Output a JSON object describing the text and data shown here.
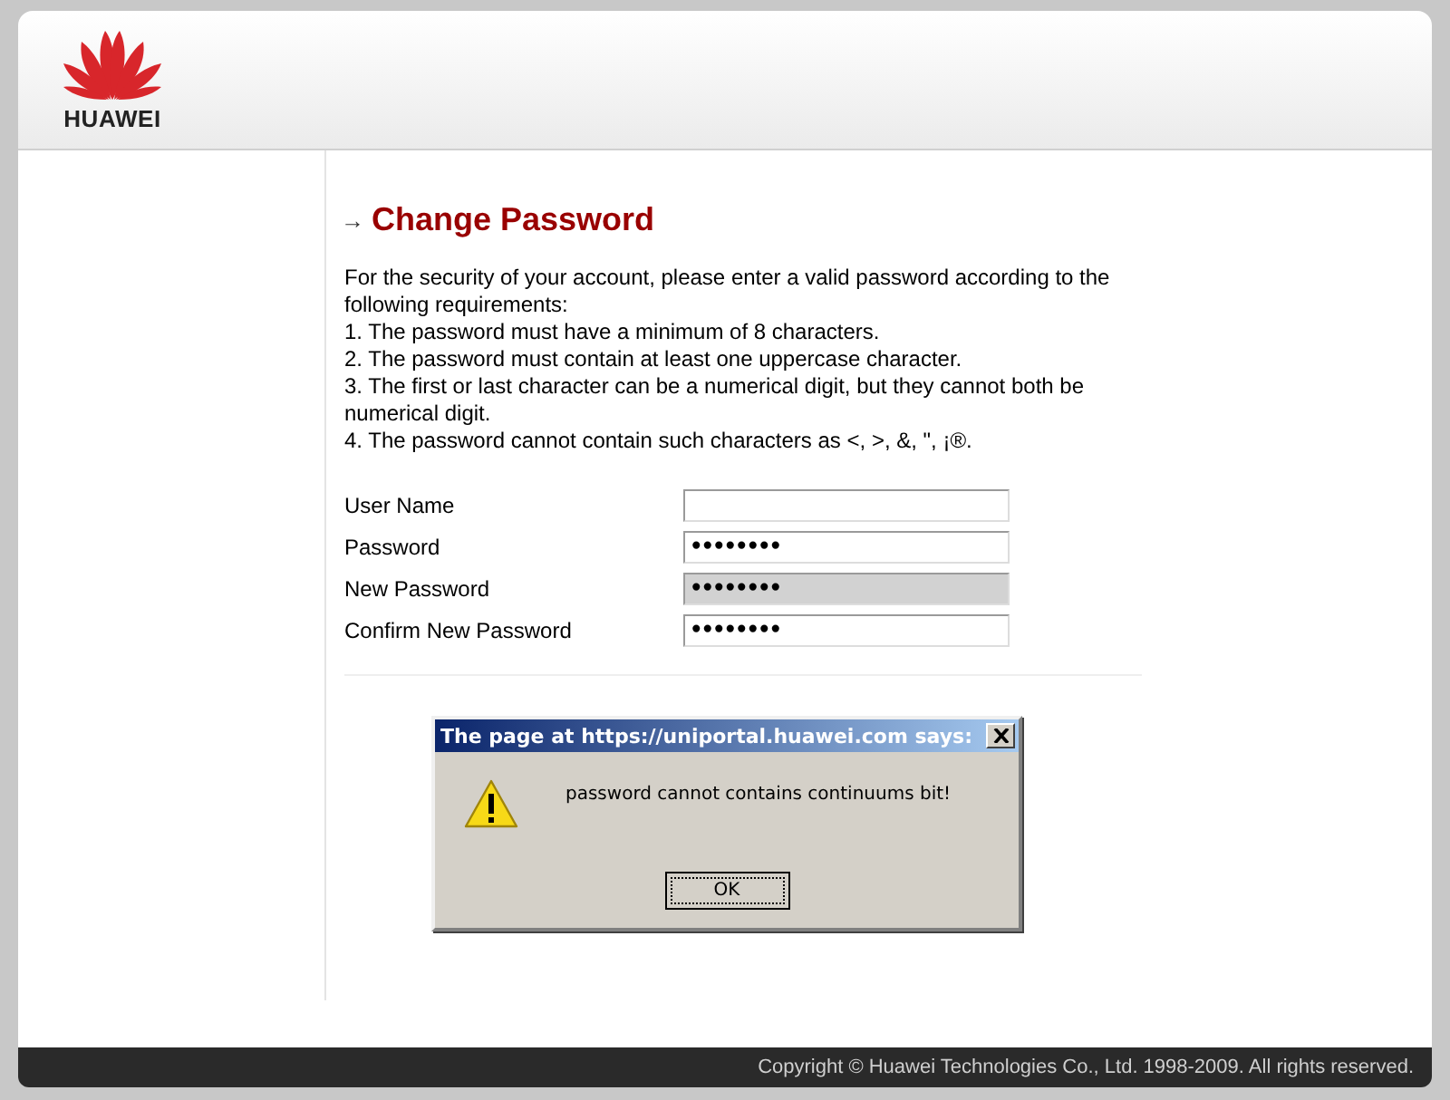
{
  "header": {
    "logo_text": "HUAWEI"
  },
  "page": {
    "title_icon": "→",
    "title": "Change Password",
    "intro": "For the security of your account, please enter a valid password according to the following requirements:",
    "requirements": [
      "1. The password must have a minimum of 8 characters.",
      "2. The password must contain at least one uppercase character.",
      "3. The first or last character can be a numerical digit, but they cannot both be numerical digit.",
      "4. The password cannot contain such characters as <, >, &, \", ¡®."
    ]
  },
  "form": [
    {
      "label": "User Name",
      "disabled": false
    },
    {
      "label": "Password",
      "value": "••••••••",
      "disabled": false
    },
    {
      "label": "New Password",
      "value": "••••••••",
      "disabled": true
    },
    {
      "label": "Confirm New Password",
      "value": "••••••••",
      "disabled": false
    }
  ],
  "dialog": {
    "title": "The page at https://uniportal.huawei.com says:",
    "message": "password cannot contains continuums bit!",
    "buttons": [
      "OK"
    ]
  },
  "footer": {
    "copyright": "Copyright © Huawei Technologies Co., Ltd. 1998-2009. All rights reserved."
  }
}
